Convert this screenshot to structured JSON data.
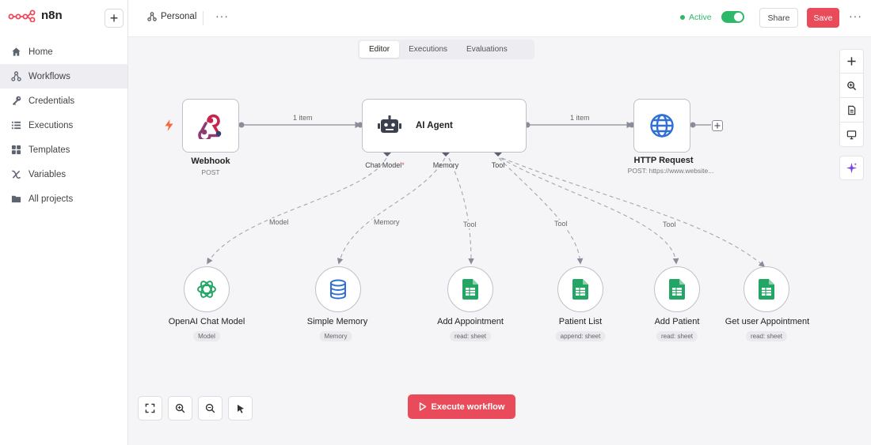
{
  "app": {
    "name": "n8n",
    "new_label": "+"
  },
  "sidebar": {
    "items": [
      {
        "label": "Home",
        "icon": "home-icon"
      },
      {
        "label": "Workflows",
        "icon": "workflow-icon",
        "active": true
      },
      {
        "label": "Credentials",
        "icon": "key-icon"
      },
      {
        "label": "Executions",
        "icon": "list-icon"
      },
      {
        "label": "Templates",
        "icon": "grid-icon"
      },
      {
        "label": "Variables",
        "icon": "variable-icon"
      },
      {
        "label": "All projects",
        "icon": "folder-icon"
      }
    ]
  },
  "header": {
    "project": "Personal",
    "more": "···",
    "status_label": "Active",
    "share_label": "Share",
    "save_label": "Save"
  },
  "tabs": [
    "Editor",
    "Executions",
    "Evaluations"
  ],
  "workflow": {
    "edges": {
      "item_label_1": "1 item",
      "item_label_2": "1 item"
    },
    "trigger": {
      "title": "Webhook",
      "subtitle": "POST"
    },
    "agent": {
      "title": "AI Agent",
      "handles": {
        "chat_model": "Chat Model",
        "required": "*",
        "memory": "Memory",
        "tool": "Tool"
      }
    },
    "http": {
      "title": "HTTP Request",
      "subtitle": "POST: https://www.website..."
    },
    "connection_labels": {
      "model": "Model",
      "memory": "Memory",
      "tool": "Tool"
    },
    "sub_nodes": [
      {
        "title": "OpenAI Chat Model",
        "badge": "Model"
      },
      {
        "title": "Simple Memory",
        "badge": "Memory"
      },
      {
        "title": "Add Appointment",
        "badge": "read: sheet"
      },
      {
        "title": "Patient List",
        "badge": "append: sheet"
      },
      {
        "title": "Add Patient",
        "badge": "read: sheet"
      },
      {
        "title": "Get user Appointment",
        "badge": "read: sheet"
      }
    ]
  },
  "execute_label": "Execute workflow",
  "colors": {
    "accent": "#ea4b5b",
    "active": "#2db86a",
    "sheets_green": "#23a566",
    "agent_blue": "#2f6fd6"
  }
}
